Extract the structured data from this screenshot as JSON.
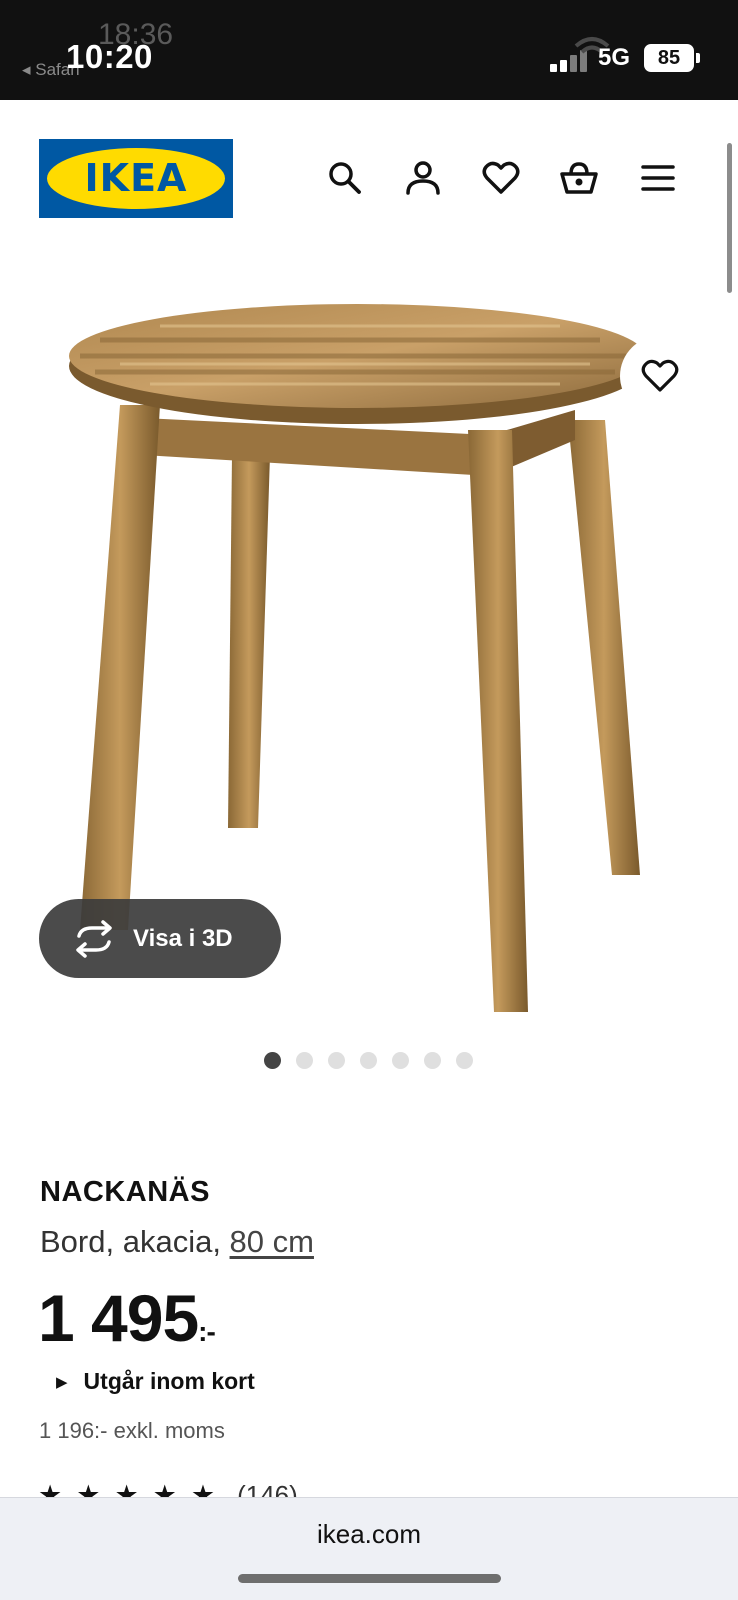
{
  "status_bar": {
    "time": "10:20",
    "ghost_time": "18:36",
    "back_label": "◂ Safari",
    "network": "5G",
    "battery": "85"
  },
  "header": {
    "logo_text": "IKEA",
    "icons": [
      "search-icon",
      "account-icon",
      "heart-icon",
      "basket-icon",
      "menu-icon"
    ]
  },
  "gallery": {
    "view_3d_label": "Visa i 3D",
    "image_count": 7,
    "active_index": 0
  },
  "product": {
    "name": "NACKANÄS",
    "description": "Bord, akacia, ",
    "size_link": "80 cm",
    "price": "1 495",
    "price_suffix": ":-",
    "stock_status": "Utgår inom kort",
    "price_ex_vat": "1 196:- exkl. moms",
    "rating_count": "(146)"
  },
  "browser": {
    "url": "ikea.com"
  },
  "colors": {
    "ikea_blue": "#0058a3",
    "ikea_yellow": "#ffdb00",
    "view3d_bg": "#3c3c3c"
  }
}
